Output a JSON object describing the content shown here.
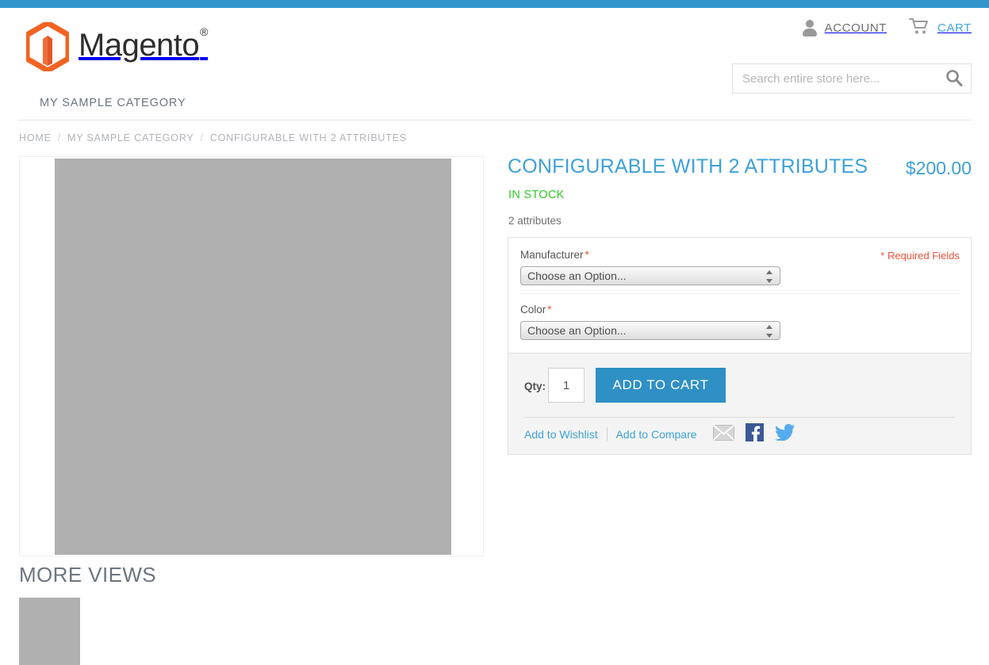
{
  "topbar": {
    "color": "#3295cc"
  },
  "header": {
    "logo_text": "Magento",
    "logo_reg": "®",
    "account_label": "ACCOUNT",
    "cart_label": "CART",
    "search": {
      "placeholder": "Search entire store here...",
      "value": ""
    }
  },
  "nav": {
    "items": [
      {
        "label": "MY SAMPLE CATEGORY"
      }
    ]
  },
  "breadcrumb": {
    "items": [
      {
        "label": "HOME"
      },
      {
        "label": "MY SAMPLE CATEGORY"
      },
      {
        "label": "CONFIGURABLE WITH 2 ATTRIBUTES"
      }
    ],
    "separator": "/"
  },
  "media": {
    "more_views_title": "MORE VIEWS",
    "placeholder_color": "#b0b0b0"
  },
  "product": {
    "title": "CONFIGURABLE WITH 2 ATTRIBUTES",
    "price": "$200.00",
    "stock_status": "IN STOCK",
    "short_description": "2 attributes",
    "options": {
      "required_note": "* Required Fields",
      "fields": [
        {
          "label": "Manufacturer",
          "required_mark": "*",
          "value": "Choose an Option..."
        },
        {
          "label": "Color",
          "required_mark": "*",
          "value": "Choose an Option..."
        }
      ]
    },
    "cart": {
      "qty_label": "Qty:",
      "qty_value": "1",
      "add_to_cart_label": "ADD TO CART",
      "wishlist_label": "Add to Wishlist",
      "compare_label": "Add to Compare"
    }
  },
  "colors": {
    "accent_blue": "#3da1da",
    "button_blue": "#2e90c5",
    "stock_green": "#2ecc26",
    "required_red": "#e8533b",
    "brand_orange": "#f26322"
  }
}
